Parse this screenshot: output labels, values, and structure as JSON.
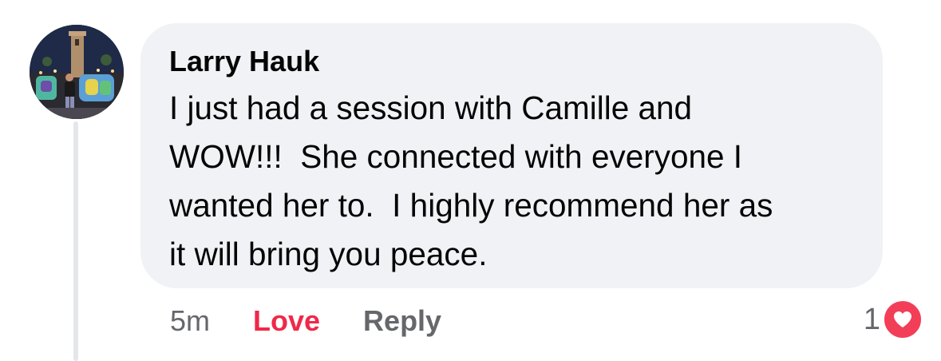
{
  "comment": {
    "author": "Larry Hauk",
    "text": "I just had a session with Camille and\nWOW!!!  She connected with everyone I\nwanted her to.  I highly recommend her as\nit will bring you peace.",
    "time": "5m",
    "love_label": "Love",
    "reply_label": "Reply",
    "reaction_count": "1",
    "reaction_icon": "heart-icon",
    "avatar_icon": "profile-photo"
  },
  "colors": {
    "bubble": "#f0f2f5",
    "love": "#f02849",
    "secondary_text": "#65676b",
    "heart_badge": "#f33e58"
  }
}
